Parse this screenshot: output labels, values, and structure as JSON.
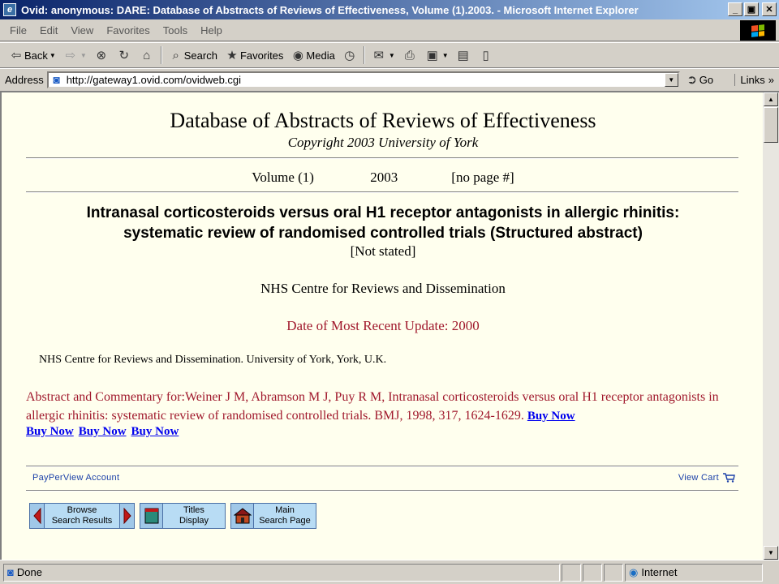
{
  "window": {
    "title": "Ovid: anonymous: DARE: Database of Abstracts of Reviews of Effectiveness, Volume (1).2003. - Microsoft Internet Explorer",
    "minimize": "_",
    "maximize": "▣",
    "close": "✕"
  },
  "menu": [
    "File",
    "Edit",
    "View",
    "Favorites",
    "Tools",
    "Help"
  ],
  "toolbar": {
    "back": "Back",
    "search": "Search",
    "favorites": "Favorites",
    "media": "Media"
  },
  "address": {
    "label": "Address",
    "url": "http://gateway1.ovid.com/ovidweb.cgi",
    "go": "Go",
    "links": "Links"
  },
  "page": {
    "db_title": "Database of Abstracts of Reviews of Effectiveness",
    "copyright": "Copyright 2003 University of York",
    "volume": "Volume (1)",
    "year": "2003",
    "page_no": "[no page #]",
    "article_title_1": "Intranasal corticosteroids versus oral H1 receptor antagonists in allergic rhinitis:",
    "article_title_2": "systematic review of randomised controlled trials (Structured abstract)",
    "not_stated": "[Not stated]",
    "centre": "NHS Centre for Reviews and Dissemination",
    "update": "Date of Most Recent Update: 2000",
    "address_line": "NHS Centre for Reviews and Dissemination. University of York, York, U.K.",
    "abstract_text": "Abstract and Commentary for:Weiner J M, Abramson M J, Puy R M, Intranasal corticosteroids versus oral H1 receptor antagonists in allergic rhinitis: systematic review of randomised controlled trials. BMJ, 1998, 317, 1624-1629.",
    "buy_now": "Buy Now",
    "payperview": "PayPerView Account",
    "view_cart": "View Cart",
    "nav": {
      "browse_1": "Browse",
      "browse_2": "Search Results",
      "titles_1": "Titles",
      "titles_2": "Display",
      "main_1": "Main",
      "main_2": "Search Page"
    }
  },
  "status": {
    "text": "Done",
    "zone": "Internet"
  },
  "colors": {
    "page_bg": "#ffffee",
    "accent_red": "#a0182c",
    "link_blue": "#0000ee"
  }
}
